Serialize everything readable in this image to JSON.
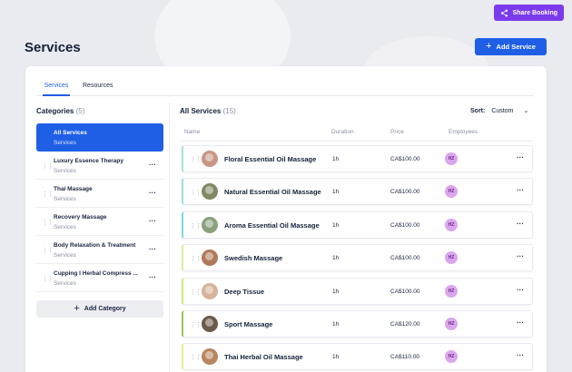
{
  "header": {
    "share_label": "Share Booking",
    "page_title": "Services",
    "add_service_label": "Add Service"
  },
  "tabs": [
    {
      "label": "Services",
      "active": true
    },
    {
      "label": "Resources",
      "active": false
    }
  ],
  "categories": {
    "title": "Categories",
    "count": "(5)",
    "items": [
      {
        "name": "All Services",
        "sub": "Services",
        "active": true
      },
      {
        "name": "Luxury Essence Therapy",
        "sub": "Services"
      },
      {
        "name": "Thai Massage",
        "sub": "Services"
      },
      {
        "name": "Recovery Massage",
        "sub": "Services"
      },
      {
        "name": "Body Relaxation & Treatment",
        "sub": "Services"
      },
      {
        "name": "Cupping I Herbal Compress ...",
        "sub": "Services"
      }
    ],
    "add_label": "Add Category"
  },
  "services": {
    "title": "All Services",
    "count": "(15)",
    "sort_label": "Sort:",
    "sort_value": "Custom",
    "columns": {
      "name": "Name",
      "duration": "Duration",
      "price": "Price",
      "employees": "Employees"
    },
    "rows": [
      {
        "name": "Floral Essential Oil Massage",
        "duration": "1h",
        "price": "CA$100.00",
        "employee": "HZ",
        "accent": "#a7e3d6"
      },
      {
        "name": "Natural Essential Oil Massage",
        "duration": "1h",
        "price": "CA$100.00",
        "employee": "HZ",
        "accent": "#9ee0dc"
      },
      {
        "name": "Aroma Essential Oil Massage",
        "duration": "1h",
        "price": "CA$100.00",
        "employee": "HZ",
        "accent": "#7fd8dc"
      },
      {
        "name": "Swedish Massage",
        "duration": "1h",
        "price": "CA$100.00",
        "employee": "HZ",
        "accent": "#d7ef9f"
      },
      {
        "name": "Deep Tissue",
        "duration": "1h",
        "price": "CA$100.00",
        "employee": "HZ",
        "accent": "#c8ec7a"
      },
      {
        "name": "Sport Massage",
        "duration": "1h",
        "price": "CA$120.00",
        "employee": "HZ",
        "accent": "#9fc45a"
      },
      {
        "name": "Thai Herbal Oil Massage",
        "duration": "1h",
        "price": "CA$110.00",
        "employee": "HZ",
        "accent": "#f3e98a"
      }
    ]
  },
  "colors": {
    "primary": "#1f5fe6",
    "share": "#7c3aed",
    "avatar": "#dba6ee"
  }
}
